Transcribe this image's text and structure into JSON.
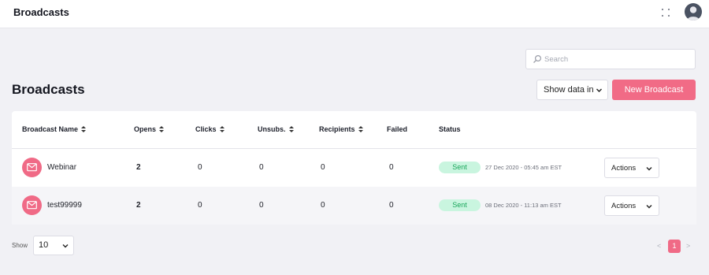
{
  "header": {
    "app_title": "Broadcasts",
    "icons": [
      "expand-icon",
      "avatar"
    ]
  },
  "search": {
    "placeholder": "Search",
    "value": ""
  },
  "page": {
    "title": "Broadcasts",
    "show_data_label": "Show data in",
    "new_button_label": "New Broadcast"
  },
  "table": {
    "columns": [
      {
        "label": "Broadcast Name",
        "sortable": true
      },
      {
        "label": "Opens",
        "sortable": true
      },
      {
        "label": "Clicks",
        "sortable": true
      },
      {
        "label": "Unsubs.",
        "sortable": true
      },
      {
        "label": "Recipients",
        "sortable": true
      },
      {
        "label": "Failed",
        "sortable": false
      },
      {
        "label": "Status",
        "sortable": false
      }
    ],
    "rows": [
      {
        "name": "Webinar",
        "opens": "2",
        "clicks": "0",
        "unsubs": "0",
        "recipients": "0",
        "failed": "0",
        "status": "Sent",
        "date": "27 Dec 2020 - 05:45 am EST",
        "actions_label": "Actions"
      },
      {
        "name": "test99999",
        "opens": "2",
        "clicks": "0",
        "unsubs": "0",
        "recipients": "0",
        "failed": "0",
        "status": "Sent",
        "date": "08 Dec 2020 - 11:13 am EST",
        "actions_label": "Actions"
      }
    ]
  },
  "footer": {
    "show_label": "Show",
    "page_size": "10",
    "pagination": {
      "prev": "<",
      "current": "1",
      "next": ">"
    }
  },
  "colors": {
    "accent": "#f06a86",
    "status_sent_bg": "#c9f5df",
    "status_sent_text": "#1aa65b",
    "page_bg": "#f1f1f5"
  }
}
